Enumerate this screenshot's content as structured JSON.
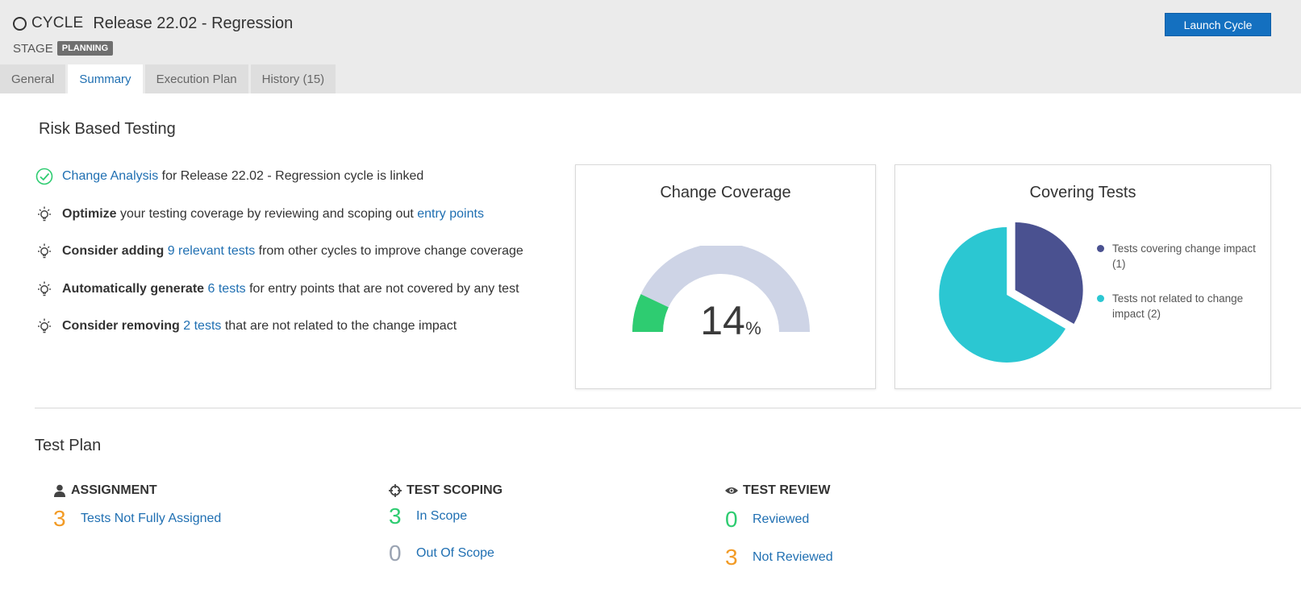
{
  "header": {
    "cycle_kind": "CYCLE",
    "cycle_title": "Release 22.02 - Regression",
    "stage_label": "STAGE",
    "stage_badge": "PLANNING",
    "launch_label": "Launch Cycle"
  },
  "tabs": [
    {
      "label": "General",
      "active": false
    },
    {
      "label": "Summary",
      "active": true
    },
    {
      "label": "Execution Plan",
      "active": false
    },
    {
      "label": "History (15)",
      "active": false
    }
  ],
  "risk_based_testing": {
    "title": "Risk Based Testing",
    "items": [
      {
        "icon": "check-circle-icon",
        "parts": [
          {
            "text": "Change Analysis",
            "link": true
          },
          {
            "text": " for Release 22.02 - Regression cycle is linked"
          }
        ]
      },
      {
        "icon": "lightbulb-icon",
        "parts": [
          {
            "text": "Optimize",
            "bold": true
          },
          {
            "text": " your testing coverage by reviewing and scoping out "
          },
          {
            "text": "entry points",
            "link": true
          }
        ]
      },
      {
        "icon": "lightbulb-icon",
        "parts": [
          {
            "text": "Consider adding",
            "bold": true
          },
          {
            "text": " "
          },
          {
            "text": "9 relevant tests",
            "link": true
          },
          {
            "text": " from other cycles to improve change coverage"
          }
        ]
      },
      {
        "icon": "lightbulb-icon",
        "parts": [
          {
            "text": "Automatically generate",
            "bold": true
          },
          {
            "text": " "
          },
          {
            "text": "6 tests",
            "link": true
          },
          {
            "text": " for entry points that are not covered by any test"
          }
        ]
      },
      {
        "icon": "lightbulb-icon",
        "parts": [
          {
            "text": "Consider removing",
            "bold": true
          },
          {
            "text": " "
          },
          {
            "text": "2 tests",
            "link": true
          },
          {
            "text": " that are not related to the change impact"
          }
        ]
      }
    ]
  },
  "change_coverage": {
    "title": "Change Coverage",
    "value": "14",
    "unit": "%",
    "fraction": 0.14,
    "fill_color": "#2ecc71",
    "track_color": "#ced4e6"
  },
  "covering_tests": {
    "title": "Covering Tests",
    "chart_data": {
      "type": "pie",
      "slices": [
        {
          "name": "Tests covering change impact (1)",
          "value": 1,
          "color": "#4a5190"
        },
        {
          "name": "Tests not related to change impact (2)",
          "value": 2,
          "color": "#2bc7d2"
        }
      ]
    }
  },
  "test_plan": {
    "title": "Test Plan",
    "assignment": {
      "heading": "ASSIGNMENT",
      "rows": [
        {
          "count": "3",
          "label": "Tests Not Fully Assigned",
          "color": "orange"
        }
      ]
    },
    "scoping": {
      "heading": "TEST SCOPING",
      "rows": [
        {
          "count": "3",
          "label": "In Scope",
          "color": "green"
        },
        {
          "count": "0",
          "label": "Out Of Scope",
          "color": "gray"
        }
      ]
    },
    "review": {
      "heading": "TEST REVIEW",
      "rows": [
        {
          "count": "0",
          "label": "Reviewed",
          "color": "green"
        },
        {
          "count": "3",
          "label": "Not Reviewed",
          "color": "orange"
        }
      ]
    }
  }
}
